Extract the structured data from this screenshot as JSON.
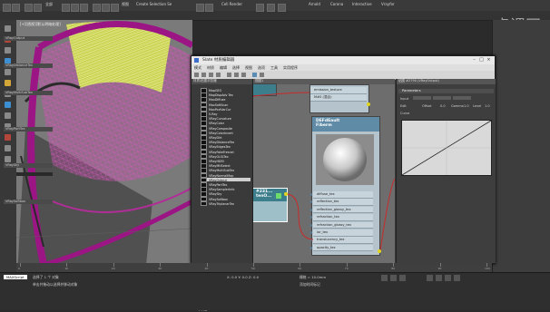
{
  "toolbar": {
    "items": [
      "全部",
      "视图",
      "Create Selection Se",
      "Cell Render",
      "Arnold",
      "Corona",
      "Interactive",
      "Vrayfor"
    ],
    "watermark": "虎课网"
  },
  "viewport": {
    "label": "[+][透视][默认明暗处理]"
  },
  "slate": {
    "title": "Slate 材质编辑器",
    "menu": [
      "模式",
      "材质",
      "编辑",
      "选择",
      "视图",
      "选项",
      "工具",
      "实用程序"
    ],
    "browser_header": "材质/贴图浏览器",
    "browser_items": [
      "MapGEO",
      "MapDispAdv Tex",
      "MaxDiffuse",
      "MaxSoftScan",
      "MaxPortVarCur",
      "V-Ray",
      "VRayCurvature",
      "VRayColor",
      "VRayComposite",
      "VRayColorInvert",
      "VRayDirt",
      "VRayDistanceTex",
      "VRayEdgesTex",
      "VRayFakeFresnel",
      "VRayGLSLTex",
      "VRayHDRI",
      "VRayMtlSelect",
      "VRayMultiSubTex",
      "VRayNormalMap",
      "VRayOutput",
      "VRayPartTex",
      "VRaySamplerInfo",
      "VRaySky",
      "VRaySoftbox",
      "VRayTriplanarTex"
    ],
    "browser_selected_index": 19,
    "browser_categories": [
      "+ 场景材质",
      "+ 示例窗",
      "+ 场景材质",
      "+ 示例窗"
    ],
    "view_tab": "视图1",
    "node_top_label": "emission_texture",
    "node_top_sub": "M#0 (混合)",
    "node_left_label": "#231...",
    "node_left_sub": "tenO...",
    "node_main_title": "DEFdEauIt",
    "node_main_sub": "Fiberm",
    "node_ports": [
      "diffuse_tex",
      "reflection_tex",
      "reflection_glossy_tex",
      "refraction_tex",
      "refraction_glossy_tex",
      "ior_tex",
      "translucency_tex",
      "opacity_tex"
    ],
    "params_header": "贴图 #2790 (VRayOutput)",
    "params_title": "Parameters",
    "params_rows": [
      "Input",
      "Edit",
      "Curve",
      "Offset",
      "Gamma",
      "Level"
    ],
    "params_values": [
      "0.0",
      "1.0",
      "1.0"
    ]
  },
  "rightpanel": {
    "rows": [
      "VRayOutput",
      "VRayDistanceTex",
      "VRayMultiSubTex",
      "VRayPartTex",
      "VRaySky",
      "VRaySoftbox"
    ]
  },
  "timeline": {
    "ticks": [
      "0",
      "10",
      "20",
      "30",
      "40",
      "50",
      "60",
      "70",
      "80",
      "90",
      "100"
    ]
  },
  "status": {
    "line1": "选择了 1 个 对象",
    "line2": "单击并拖动以选择并移动对象",
    "coords": "X: 0.0   Y: 0.0   Z: 0.0",
    "grid": "栅格 = 10.0mm",
    "addtime": "添加时间标记"
  },
  "colors": {
    "accent": "#e0d51b",
    "wire_magenta": "#c2209a",
    "node_head": "#5f8ba6"
  }
}
